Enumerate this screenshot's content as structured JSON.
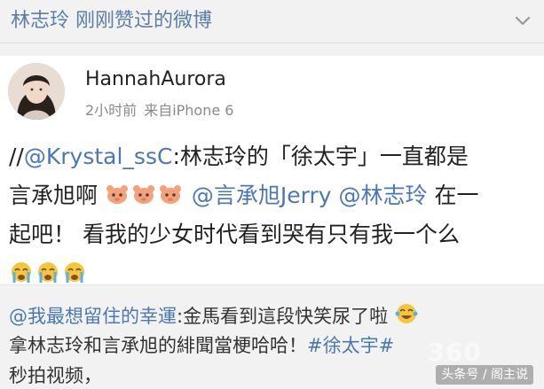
{
  "header": {
    "title": "林志玲 刚刚赞过的微博",
    "menu_icon": "chevron-down-icon"
  },
  "post": {
    "user_name": "HannahAurora",
    "time": "2小时前",
    "source": "来自iPhone 6",
    "lines": [
      {
        "prefix": "//",
        "mention": "@Krystal_ssC",
        "text": ":林志玲的「徐太宇」一直都是"
      },
      {
        "text_a": "言承旭啊",
        "emoji_count": 3,
        "mention_a": "@言承旭Jerry",
        "mention_b": "@林志玲",
        "text_b": "在一"
      },
      {
        "text": "起吧！ 看我的少女时代看到哭有只有我一个么"
      },
      {
        "emoji_count": 3
      }
    ]
  },
  "repost": {
    "mention": "@我最想留住的幸運",
    "line1_text": ":金馬看到這段快笑尿了啦",
    "line2_text": "拿林志玲和言承旭的緋聞當梗哈哈！",
    "topic": "#徐太宇#",
    "line3_text": "秒拍视频，"
  },
  "watermark": {
    "label": "头条号 / 阁主说",
    "logo": "360"
  },
  "colors": {
    "link": "#4a78b4",
    "header_title": "#5a7ea8"
  }
}
